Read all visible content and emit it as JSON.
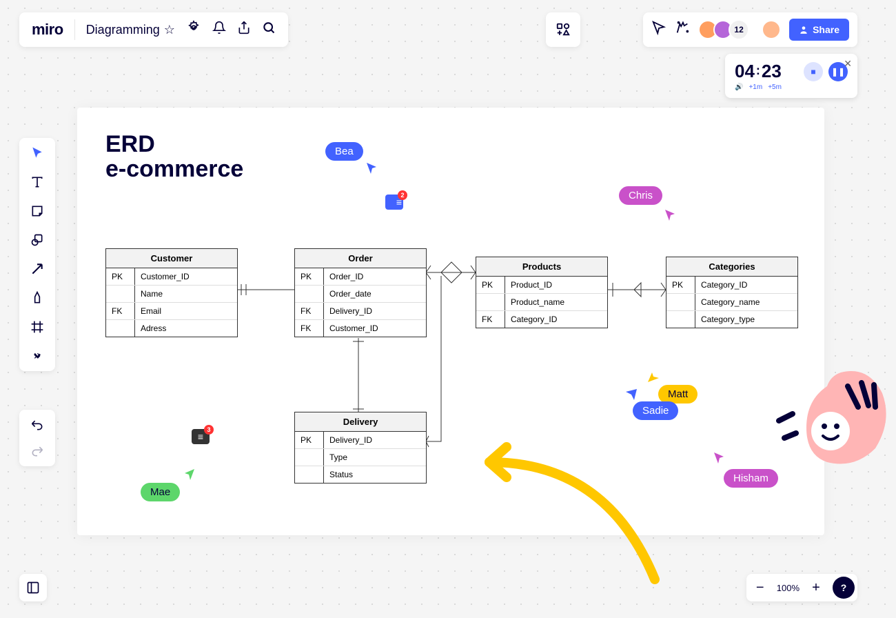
{
  "header": {
    "logo": "miro",
    "board_name": "Diagramming"
  },
  "collab": {
    "extra_count": "12",
    "share_label": "Share"
  },
  "timer": {
    "minutes": "04",
    "seconds": "23",
    "add1": "+1m",
    "add5": "+5m"
  },
  "title": {
    "line1": "ERD",
    "line2": "e-commerce"
  },
  "entities": {
    "customer": {
      "name": "Customer",
      "rows": [
        {
          "key": "PK",
          "field": "Customer_ID"
        },
        {
          "key": "",
          "field": "Name"
        },
        {
          "key": "FK",
          "field": "Email"
        },
        {
          "key": "",
          "field": "Adress"
        }
      ]
    },
    "order": {
      "name": "Order",
      "rows": [
        {
          "key": "PK",
          "field": "Order_ID"
        },
        {
          "key": "",
          "field": "Order_date"
        },
        {
          "key": "FK",
          "field": "Delivery_ID"
        },
        {
          "key": "FK",
          "field": "Customer_ID"
        }
      ]
    },
    "products": {
      "name": "Products",
      "rows": [
        {
          "key": "PK",
          "field": "Product_ID"
        },
        {
          "key": "",
          "field": "Product_name"
        },
        {
          "key": "FK",
          "field": "Category_ID"
        }
      ]
    },
    "categories": {
      "name": "Categories",
      "rows": [
        {
          "key": "PK",
          "field": "Category_ID"
        },
        {
          "key": "",
          "field": "Category_name"
        },
        {
          "key": "",
          "field": "Category_type"
        }
      ]
    },
    "delivery": {
      "name": "Delivery",
      "rows": [
        {
          "key": "PK",
          "field": "Delivery_ID"
        },
        {
          "key": "",
          "field": "Type"
        },
        {
          "key": "",
          "field": "Status"
        }
      ]
    }
  },
  "cursors": {
    "bea": "Bea",
    "chris": "Chris",
    "matt": "Matt",
    "sadie": "Sadie",
    "hisham": "Hisham",
    "mae": "Mae"
  },
  "comments": {
    "c1_count": "2",
    "c2_count": "3"
  },
  "zoom": {
    "level": "100%"
  },
  "colors": {
    "bea": "#4262ff",
    "chris": "#c951c9",
    "matt": "#ffc700",
    "sadie": "#4262ff",
    "hisham": "#c951c9",
    "mae": "#5dd66b"
  }
}
